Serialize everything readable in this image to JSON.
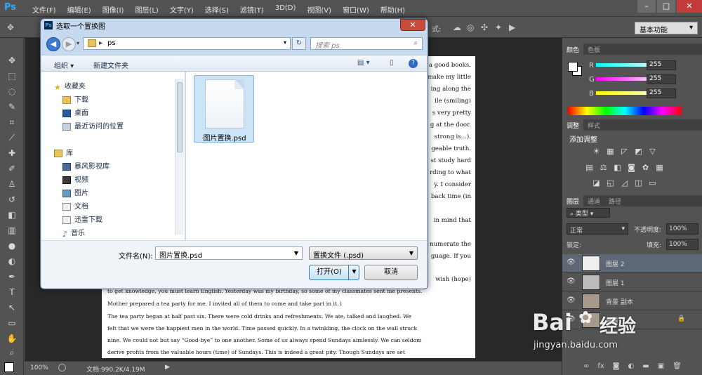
{
  "menubar": {
    "logo": "Ps",
    "items": [
      "文件(F)",
      "编辑(E)",
      "图像(I)",
      "图层(L)",
      "文字(Y)",
      "选择(S)",
      "滤镜(T)",
      "3D(D)",
      "视图(V)",
      "窗口(W)",
      "帮助(H)"
    ],
    "window_controls": [
      "–",
      "□",
      "✕"
    ]
  },
  "options_bar": {
    "workspace": "基本功能",
    "mode_label": "式:"
  },
  "document": {
    "lines": [
      " a good books.",
      "make my little",
      "ing along the",
      "ile (smiling)",
      "s very pretty",
      "g at the door.",
      "strong is...).",
      "geable truth.",
      "st study hard",
      "rding to what",
      "y. I consider",
      "back time (in",
      "",
      "in mind that",
      "",
      "numerate the",
      "guage. If you",
      "",
      "wish (hope)",
      "to get knowledge, you must learn English. Yesterday was my birthday, so some of my classmates sent me presents.",
      "Mother prepared a tea party for me. I invited all of them to come and take part in it.↓",
      "The tea party began at half past six. There were cold drinks and refreshments. We ate, talked and laughed. We",
      "felt that we were the happiest men in the world. Time passed quickly. In a twinkling, the clock on the wall struck",
      "nine. We could not but say “Good-bye” to one another.  Some of us always spend Sundays aimlessly. We can seldom",
      "derive profits from the valuable hours (time) of Sundays. This is indeed a great pity. Though Sundays are set"
    ]
  },
  "status": {
    "zoom": "100%",
    "doc_size": "文档:990.2K/4.19M"
  },
  "color_panel": {
    "tabs": [
      "颜色",
      "色板"
    ],
    "channels": [
      {
        "label": "R",
        "value": "255"
      },
      {
        "label": "G",
        "value": "255"
      },
      {
        "label": "B",
        "value": "255"
      }
    ]
  },
  "adjust_panel": {
    "tabs": [
      "调整",
      "样式"
    ],
    "title": "添加调整"
  },
  "layers_panel": {
    "tabs": [
      "图层",
      "通道",
      "路径"
    ],
    "filter_kind": "类型",
    "blend_mode": "正常",
    "opacity_label": "不透明度:",
    "opacity": "100%",
    "lock_label": "锁定:",
    "fill_label": "填充:",
    "fill": "100%",
    "layers": [
      {
        "name": "图层 2",
        "selected": true
      },
      {
        "name": "图层 1",
        "selected": false
      },
      {
        "name": "背景 副本",
        "selected": false
      },
      {
        "name": "背景",
        "selected": false
      }
    ]
  },
  "dialog": {
    "title": "选取一个置换图",
    "path": "ps",
    "search_placeholder": "搜索 ps",
    "cmd_organize": "组织 ▾",
    "cmd_new_folder": "新建文件夹",
    "nav": {
      "favorites": "收藏夹",
      "fav_items": [
        "下载",
        "桌面",
        "最近访问的位置"
      ],
      "library": "库",
      "lib_items": [
        "暴风影视库",
        "视频",
        "图片",
        "文档",
        "迅雷下载",
        "音乐"
      ]
    },
    "file": "图片置换.psd",
    "filename_label": "文件名(N):",
    "filename_value": "图片置换.psd",
    "filetype": "置换文件 (.psd)",
    "open_label": "打开(O)",
    "cancel_label": "取消"
  },
  "watermark": {
    "brand": "Bai",
    "brand2": "经验",
    "url": "jingyan.baidu.com"
  }
}
